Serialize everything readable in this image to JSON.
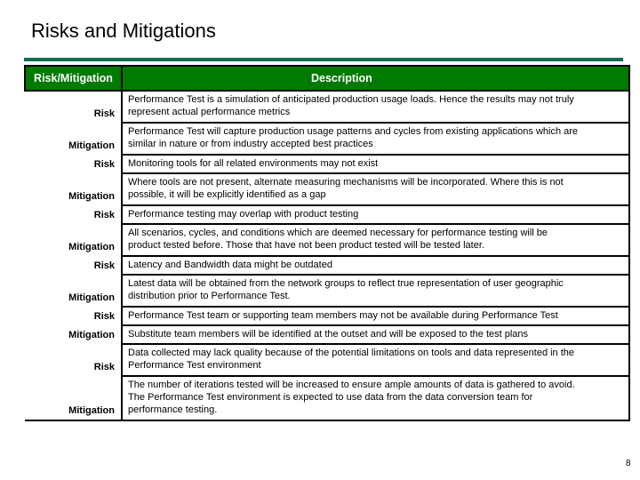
{
  "slide": {
    "title": "Risks and Mitigations",
    "page_number": "8",
    "accent_color": "#0e6e4a",
    "header_color": "#007a00"
  },
  "table": {
    "headers": [
      "Risk/Mitigation",
      "Description"
    ],
    "rows": [
      {
        "type": "Risk",
        "description": "Performance Test is a simulation of anticipated production usage loads.  Hence the results may not truly\nrepresent actual performance metrics"
      },
      {
        "type": "Mitigation",
        "description": "Performance Test will capture production usage patterns and cycles from existing applications which are\nsimilar in nature or from industry accepted best practices"
      },
      {
        "type": "Risk",
        "description": "Monitoring tools for all related environments may not exist"
      },
      {
        "type": "Mitigation",
        "description": "Where tools are not present, alternate measuring mechanisms will be incorporated.  Where this is not\npossible, it will be explicitly identified as a gap"
      },
      {
        "type": "Risk",
        "description": "Performance testing may overlap with product testing"
      },
      {
        "type": "Mitigation",
        "description": "All scenarios, cycles, and conditions which are deemed necessary for performance testing will be\nproduct tested before.  Those that have not been product tested will be tested later."
      },
      {
        "type": "Risk",
        "description": "Latency and Bandwidth data might be outdated"
      },
      {
        "type": "Mitigation",
        "description": "Latest data will be obtained from the network groups to reflect true representation of user geographic\ndistribution prior to Performance Test."
      },
      {
        "type": "Risk",
        "description": "Performance Test team or supporting team members may not be available during Performance Test"
      },
      {
        "type": "Mitigation",
        "description": "Substitute team members will be identified at the outset and will be exposed to the test plans"
      },
      {
        "type": "Risk",
        "description": "Data collected may lack quality because of the potential limitations on tools and data represented in the\nPerformance Test environment"
      },
      {
        "type": "Mitigation",
        "description": "The number of iterations tested will be increased to ensure ample amounts of data is gathered to avoid.\nThe Performance Test environment is expected to use data from the data conversion team for\nperformance testing."
      }
    ]
  }
}
